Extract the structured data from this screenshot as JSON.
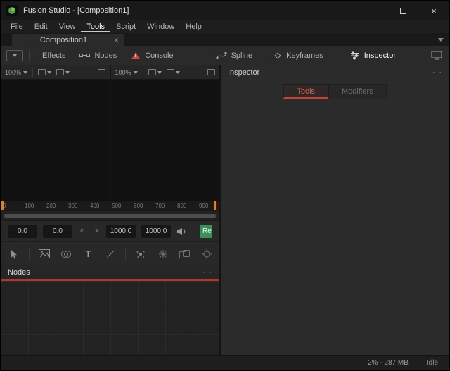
{
  "window": {
    "title": "Fusion Studio - [Composition1]",
    "accent_red": "#b5352c",
    "render_green": "#3e8e5c"
  },
  "menu": {
    "items": [
      "File",
      "Edit",
      "View",
      "Tools",
      "Script",
      "Window",
      "Help"
    ],
    "active_item": "Tools"
  },
  "tabbar": {
    "tab_label": "Composition1"
  },
  "toolbar": {
    "effects": "Effects",
    "nodes": "Nodes",
    "console": "Console",
    "spline": "Spline",
    "keyframes": "Keyframes",
    "inspector": "Inspector"
  },
  "viewers": {
    "left": {
      "zoom": "100%"
    },
    "right": {
      "zoom": "100%"
    }
  },
  "ruler": {
    "ticks": [
      "0",
      "100",
      "200",
      "300",
      "400",
      "500",
      "600",
      "700",
      "800",
      "900"
    ]
  },
  "time": {
    "current": "0.0",
    "range_start": "0.0",
    "range_end": "1000.0",
    "global_end": "1000.0",
    "render_label": "Re"
  },
  "nodes_panel": {
    "title": "Nodes"
  },
  "inspector": {
    "title": "Inspector",
    "tabs": [
      "Tools",
      "Modifiers"
    ],
    "active_tab": "Tools"
  },
  "status": {
    "memory": "2% - 287 MB",
    "state": "Idle"
  },
  "glyphs": {
    "close": "×",
    "tab_close": "×",
    "menu_dots": "···",
    "prev": "<",
    "next": ">",
    "text_tool": "T"
  }
}
